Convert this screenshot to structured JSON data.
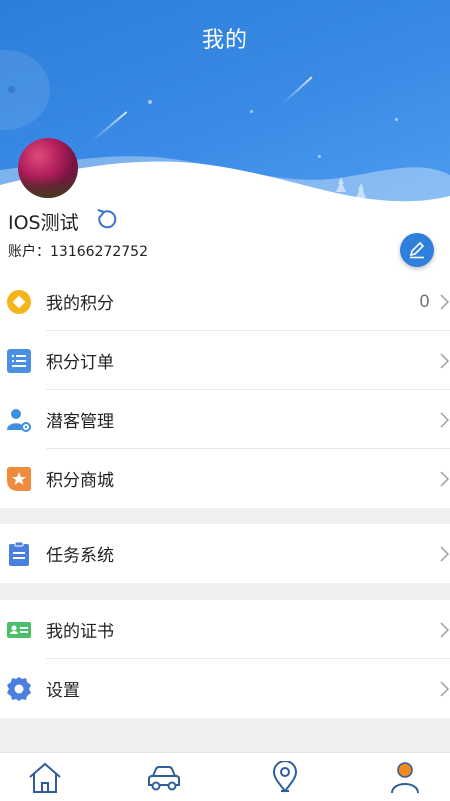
{
  "header": {
    "title": "我的"
  },
  "profile": {
    "username": "IOS测试",
    "account_label": "账户：",
    "account_number": "13166272752"
  },
  "groups": [
    {
      "items": [
        {
          "label": "我的积分",
          "value": "0",
          "icon": "points-diamond-icon",
          "color": "#f4b41a"
        },
        {
          "label": "积分订单",
          "icon": "order-list-icon",
          "color": "#4a90e2"
        },
        {
          "label": "潜客管理",
          "icon": "customer-manage-icon",
          "color": "#3d8fe0"
        },
        {
          "label": "积分商城",
          "icon": "mall-star-icon",
          "color": "#f08a3c"
        }
      ]
    },
    {
      "items": [
        {
          "label": "任务系统",
          "icon": "task-clipboard-icon",
          "color": "#4a7fe0"
        }
      ]
    },
    {
      "items": [
        {
          "label": "我的证书",
          "icon": "certificate-icon",
          "color": "#4cbf6a"
        },
        {
          "label": "设置",
          "icon": "settings-gear-icon",
          "color": "#4a7fe0"
        }
      ]
    }
  ],
  "tabbar": [
    {
      "name": "home",
      "icon": "home-icon",
      "active": false
    },
    {
      "name": "car",
      "icon": "car-icon",
      "active": false
    },
    {
      "name": "location",
      "icon": "location-pin-icon",
      "active": false
    },
    {
      "name": "mine",
      "icon": "user-icon",
      "active": true
    }
  ],
  "colors": {
    "accent": "#2f7fdc",
    "active_tab": "#f08a1c"
  }
}
